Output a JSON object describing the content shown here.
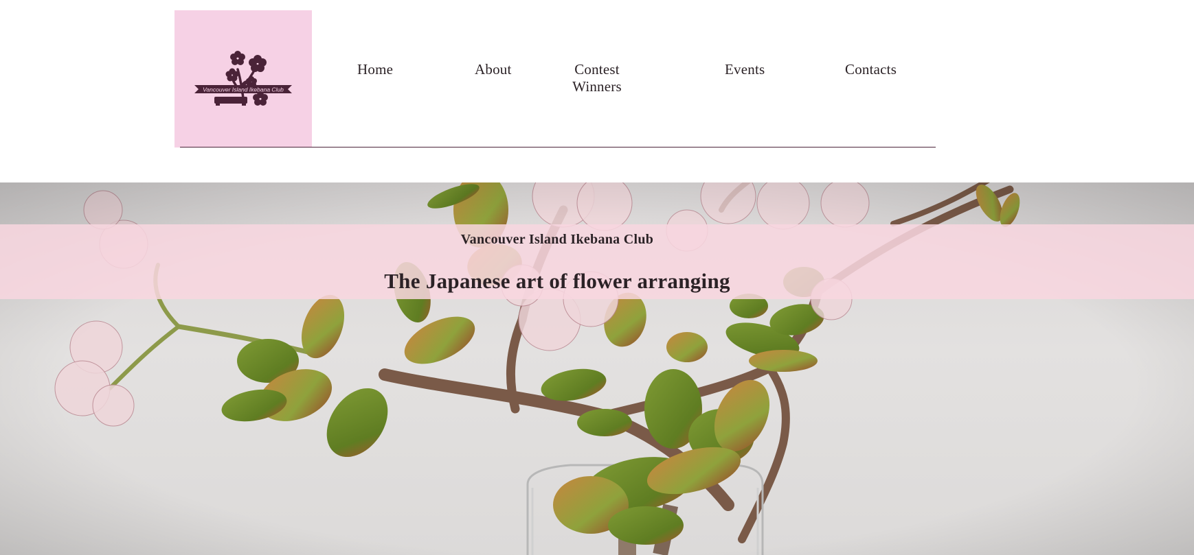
{
  "header": {
    "logo": {
      "icon": "ikebana-bonsai-logo-icon",
      "banner_text": "Vancouver Island Ikebana Club",
      "background_color": "#f6d1e5",
      "ink_color": "#4a2338"
    },
    "nav": {
      "items": [
        {
          "label": "Home"
        },
        {
          "label": "About"
        },
        {
          "label": "Contest Winners"
        },
        {
          "label": "Events"
        },
        {
          "label": "Contacts"
        }
      ]
    },
    "rule_color": "#4a2338"
  },
  "hero": {
    "image": "ikebana-jade-plant-arrangement",
    "band_color": "#f8d6e0",
    "kicker": "Vancouver Island Ikebana Club",
    "title": "The Japanese art of flower arranging"
  }
}
